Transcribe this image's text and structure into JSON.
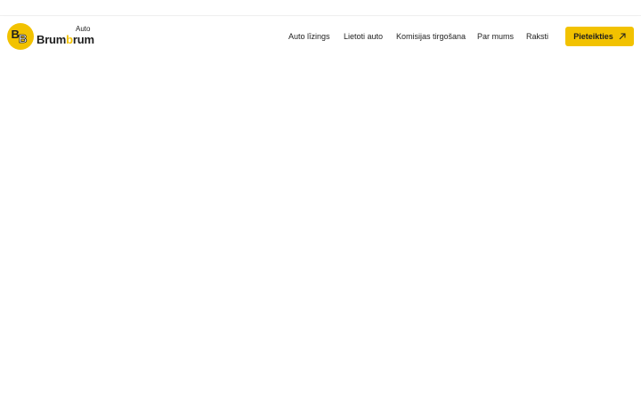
{
  "brand": {
    "word_a": "Brum",
    "word_b": "b",
    "word_c": "rum",
    "sup": "Auto",
    "mark_letters": "BB",
    "accent_color": "#f2c200",
    "text_color": "#1e1e1e"
  },
  "nav": {
    "items": [
      {
        "label": "Auto līzings"
      },
      {
        "label": "Lietoti auto"
      },
      {
        "label": "Komisijas tirgošana"
      },
      {
        "label": "Par mums"
      },
      {
        "label": "Raksti"
      }
    ]
  },
  "cta": {
    "label": "Pieteikties",
    "icon": "arrow-up-right-icon"
  }
}
